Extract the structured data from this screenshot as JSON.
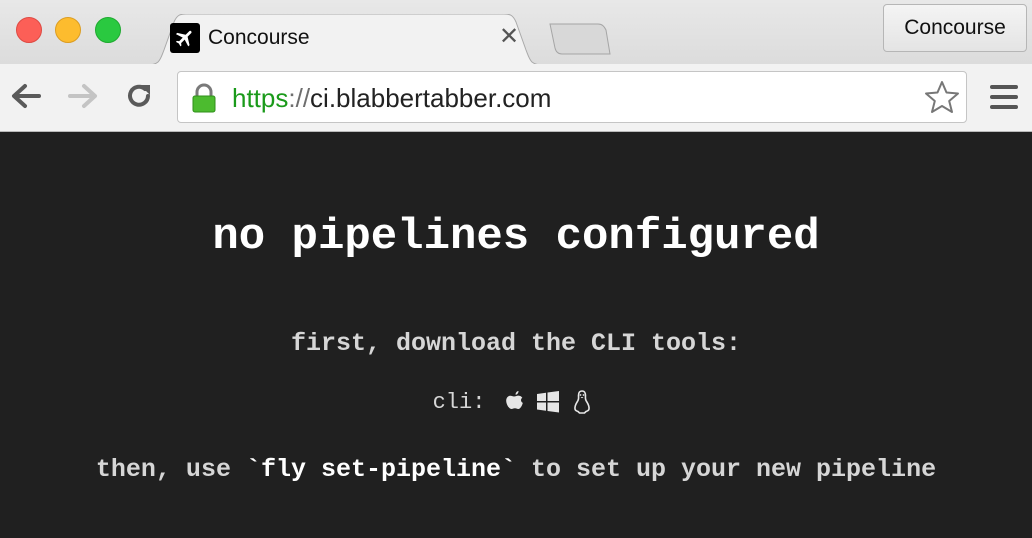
{
  "browser": {
    "tab": {
      "title": "Concourse",
      "close_glyph": "✕",
      "favicon": "airplane-icon"
    },
    "profile_button_label": "Concourse",
    "address_bar": {
      "scheme": "https",
      "separator": "://",
      "host": "ci.blabbertabber.com"
    },
    "icons": [
      "back-arrow-icon",
      "forward-arrow-icon",
      "reload-icon",
      "lock-icon",
      "star-icon",
      "hamburger-menu-icon"
    ]
  },
  "page": {
    "headline": "no pipelines configured",
    "download_prompt": "first, download the CLI tools:",
    "cli_label": "cli:",
    "cli_platforms": [
      "apple-icon",
      "windows-icon",
      "linux-icon"
    ],
    "instruction_prefix": "then, use ",
    "instruction_command": "`fly set-pipeline`",
    "instruction_suffix": " to set up your new pipeline"
  },
  "colors": {
    "page_background": "#202020",
    "url_scheme": "#1a9a1a",
    "text_primary": "#ffffff",
    "text_secondary": "#d6d6d6"
  }
}
